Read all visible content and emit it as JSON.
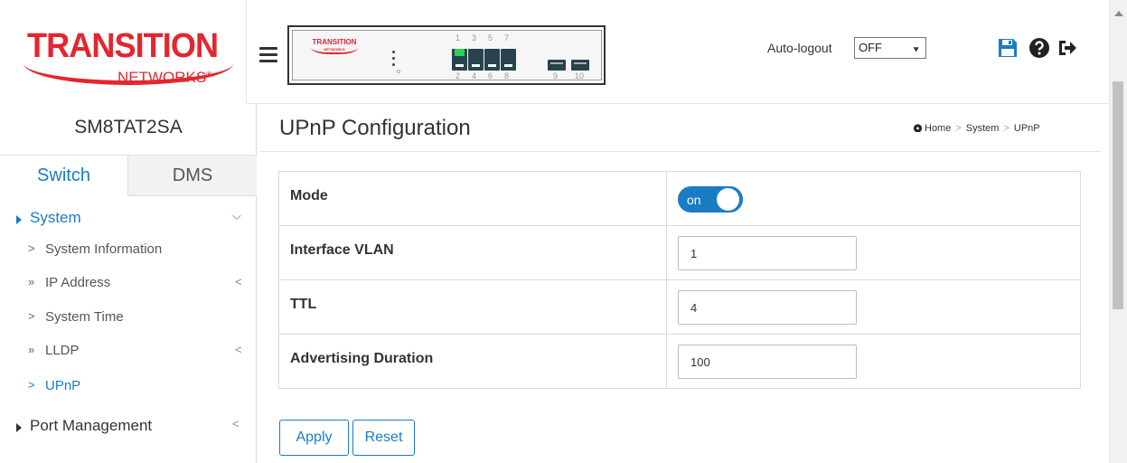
{
  "header": {
    "logo": {
      "main": "TRANSITION",
      "sub": "NETWORKS"
    },
    "device_image": {
      "logo_text": "TRANSITION",
      "logo_subtext": "NETWORKS",
      "port_numbers_top": [
        "1",
        "3",
        "5",
        "7"
      ],
      "port_numbers_bottom": [
        "2",
        "4",
        "6",
        "8",
        "9",
        "10"
      ],
      "port_up_color": "#2ad35a",
      "port_color": "#27434d"
    },
    "auto_logout_label": "Auto-logout",
    "auto_logout_value": "OFF",
    "icons": [
      "menu-icon",
      "save-icon",
      "help-icon",
      "logout-icon"
    ],
    "accent_color": "#1a7cc4"
  },
  "sidebar": {
    "device_name": "SM8TAT2SA",
    "tabs": [
      {
        "label": "Switch",
        "active": true
      },
      {
        "label": "DMS",
        "active": false
      }
    ],
    "groups": [
      {
        "label": "System",
        "expanded": true,
        "active": true
      },
      {
        "label": "Port Management",
        "expanded": false,
        "active": false
      }
    ],
    "items": [
      {
        "label": "System Information",
        "marker": ">",
        "has_submenu": false
      },
      {
        "label": "IP Address",
        "marker": "»",
        "has_submenu": true
      },
      {
        "label": "System Time",
        "marker": ">",
        "has_submenu": false
      },
      {
        "label": "LLDP",
        "marker": "»",
        "has_submenu": true
      },
      {
        "label": "UPnP",
        "marker": ">",
        "has_submenu": false,
        "active": true
      }
    ]
  },
  "main": {
    "title": "UPnP Configuration",
    "breadcrumb": [
      "Home",
      "System",
      "UPnP"
    ],
    "fields": {
      "mode": {
        "label": "Mode",
        "value": "on"
      },
      "interface_vlan": {
        "label": "Interface VLAN",
        "value": "1"
      },
      "ttl": {
        "label": "TTL",
        "value": "4"
      },
      "advertising_duration": {
        "label": "Advertising Duration",
        "value": "100"
      }
    },
    "buttons": {
      "apply": "Apply",
      "reset": "Reset"
    }
  }
}
